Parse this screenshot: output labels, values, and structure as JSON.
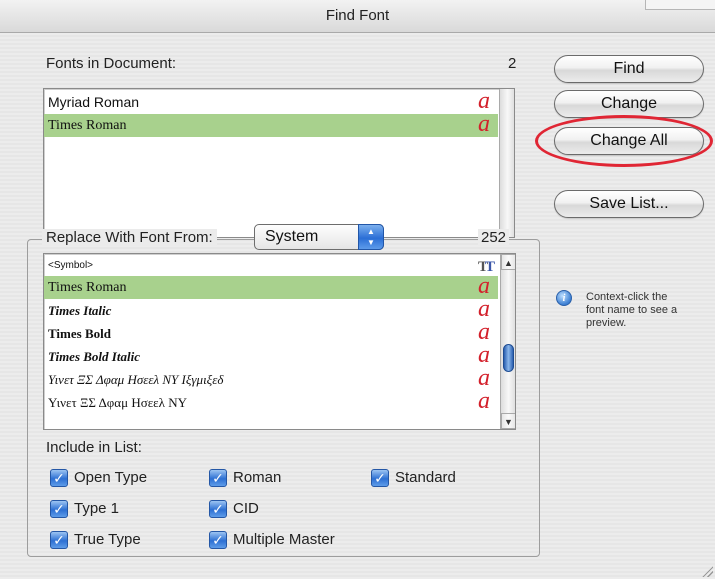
{
  "window": {
    "title": "Find Font"
  },
  "fonts_in_document": {
    "label": "Fonts in Document:",
    "count": "2",
    "items": [
      {
        "name": "Myriad Roman",
        "selected": false,
        "icon": "a"
      },
      {
        "name": "Times Roman",
        "selected": true,
        "icon": "a"
      }
    ]
  },
  "buttons": {
    "find": "Find",
    "change": "Change",
    "change_all": "Change All",
    "save_list": "Save List..."
  },
  "replace": {
    "label": "Replace With Font From:",
    "source": "System",
    "count": "252",
    "items": [
      {
        "name": "<Symbol>",
        "selected": false,
        "icon": "truetype-icon"
      },
      {
        "name": "Times Roman",
        "selected": true,
        "icon": "a"
      },
      {
        "name": "Times Italic",
        "selected": false,
        "icon": "a"
      },
      {
        "name": "Times Bold",
        "selected": false,
        "icon": "a"
      },
      {
        "name": "Times Bold Italic",
        "selected": false,
        "icon": "a"
      },
      {
        "name": "Υινετ ΞΣ Δφαμ Ησεελ ΝΥ Ιξγμιξεδ",
        "selected": false,
        "icon": "a"
      },
      {
        "name": "Υινετ ΞΣ Δφαμ Ησεελ ΝΥ",
        "selected": false,
        "icon": "a"
      }
    ]
  },
  "include": {
    "label": "Include in List:",
    "options": {
      "open_type": "Open Type",
      "type1": "Type 1",
      "true_type": "True Type",
      "roman": "Roman",
      "cid": "CID",
      "multiple_master": "Multiple Master",
      "standard": "Standard"
    }
  },
  "tip": {
    "line1": "Context-click the",
    "line2": "font name to see a",
    "line3": "preview."
  },
  "colors": {
    "selection": "#a8d18d",
    "accent_red": "#e02634",
    "aqua_blue": "#2d70d3"
  }
}
